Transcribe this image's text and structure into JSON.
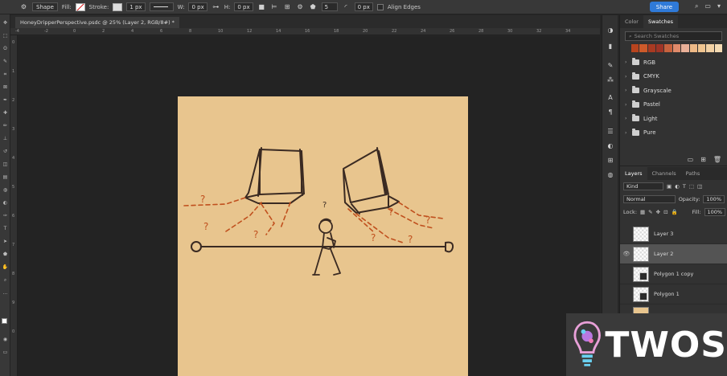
{
  "options_bar": {
    "mode": "Shape",
    "fill_label": "Fill:",
    "stroke_label": "Stroke:",
    "stroke_width": "1 px",
    "w_label": "W:",
    "w_value": "0 px",
    "h_label": "H:",
    "h_value": "0 px",
    "sides": "5",
    "radius": "0 px",
    "align_edges": "Align Edges",
    "share": "Share"
  },
  "document": {
    "tab_title": "HoneyDripperPerspective.psdc @ 25% (Layer 2, RGB/8#) *"
  },
  "rulers": {
    "h": [
      "-4",
      "-2",
      "0",
      "2",
      "4",
      "6",
      "8",
      "10",
      "12",
      "14",
      "16",
      "18",
      "20",
      "22",
      "24",
      "26",
      "28",
      "30",
      "32",
      "34"
    ],
    "v": [
      "0",
      "1",
      "2",
      "3",
      "4",
      "5",
      "6",
      "7",
      "8",
      "9",
      "0"
    ]
  },
  "swatches_panel": {
    "tabs": [
      "Color",
      "Swatches"
    ],
    "search_placeholder": "Search Swatches",
    "recent_colors": [
      "#b8441e",
      "#cd5a2a",
      "#a83a22",
      "#9e3426",
      "#c7623e",
      "#e08a6a",
      "#e9b098",
      "#eeb986",
      "#f0c590",
      "#f2d1a4",
      "#f4dbb4"
    ],
    "groups": [
      "RGB",
      "CMYK",
      "Grayscale",
      "Pastel",
      "Light",
      "Pure"
    ]
  },
  "layers_panel": {
    "tabs": [
      "Layers",
      "Channels",
      "Paths"
    ],
    "filter": "Kind",
    "blend_mode": "Normal",
    "opacity_label": "Opacity:",
    "opacity_value": "100%",
    "lock_label": "Lock:",
    "fill_label": "Fill:",
    "fill_value": "100%",
    "layers": [
      {
        "name": "Layer 3",
        "selected": false,
        "visible": false
      },
      {
        "name": "Layer 2",
        "selected": true,
        "visible": true
      },
      {
        "name": "Polygon 1 copy",
        "selected": false,
        "visible": false
      },
      {
        "name": "Polygon 1",
        "selected": false,
        "visible": false
      }
    ]
  },
  "watermark": {
    "text": "TWOS"
  },
  "colors": {
    "canvas": "#e8c58e",
    "accent_blue": "#2f7ad9",
    "sketch_ink": "#3a2a22",
    "question_marks": "#c0501e"
  }
}
